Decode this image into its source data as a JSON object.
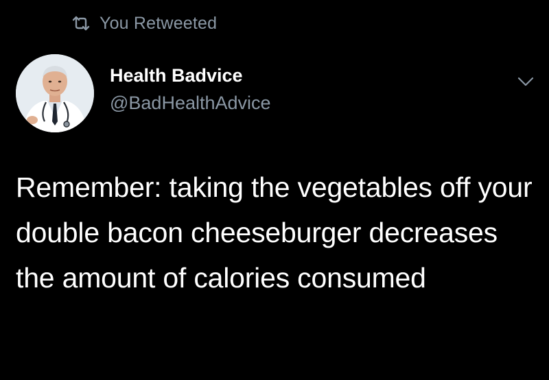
{
  "retweet": {
    "label": "You Retweeted",
    "icon": "retweet-icon"
  },
  "author": {
    "display_name": "Health Badvice",
    "handle": "@BadHealthAdvice",
    "avatar": "doctor-avatar"
  },
  "menu": {
    "icon": "chevron-down-icon"
  },
  "tweet": {
    "text": "Remember: taking the vegetables off your double bacon cheeseburger decreases the amount of calories consumed"
  },
  "colors": {
    "background": "#000000",
    "primary_text": "#ffffff",
    "secondary_text": "#8b98a5"
  }
}
